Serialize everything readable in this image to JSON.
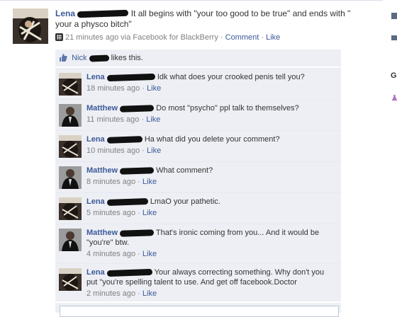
{
  "post": {
    "author": "Lena",
    "message": "It all begins with \"your too good to be true\" and ends with \" your a physco bitch\"",
    "time": "21 minutes ago",
    "via": "via Facebook for BlackBerry",
    "comment_label": "Comment",
    "like_label": "Like",
    "sep": "·"
  },
  "likes": {
    "name": "Nick",
    "text": "likes this."
  },
  "comments": [
    {
      "author": "Lena",
      "text": "Idk what does your crooked penis tell you?",
      "time": "18 minutes ago",
      "like": "Like"
    },
    {
      "author": "Matthew",
      "text": "Do most \"psycho\" ppl talk to themselves?",
      "time": "11 minutes ago",
      "like": "Like"
    },
    {
      "author": "Lena",
      "text": "Ha what did you delete your comment?",
      "time": "10 minutes ago",
      "like": "Like"
    },
    {
      "author": "Matthew",
      "text": "What comment?",
      "time": "8 minutes ago",
      "like": "Like"
    },
    {
      "author": "Lena",
      "text": "LmaO your pathetic.",
      "time": "5 minutes ago",
      "like": "Like"
    },
    {
      "author": "Matthew",
      "text": "That's ironic coming from you... And it would be \"you're\" btw.",
      "time": "4 minutes ago",
      "like": "Like"
    },
    {
      "author": "Lena",
      "text": "Your always correcting something. Why don't you put \"you're spelling talent to use. And get off facebook.Doctor",
      "time": "2 minutes ago",
      "like": "Like"
    }
  ],
  "sidebar_right": {
    "letter": "G"
  },
  "colors": {
    "link": "#3b5998",
    "comment_bg": "#edeff4",
    "meta": "#808080"
  }
}
